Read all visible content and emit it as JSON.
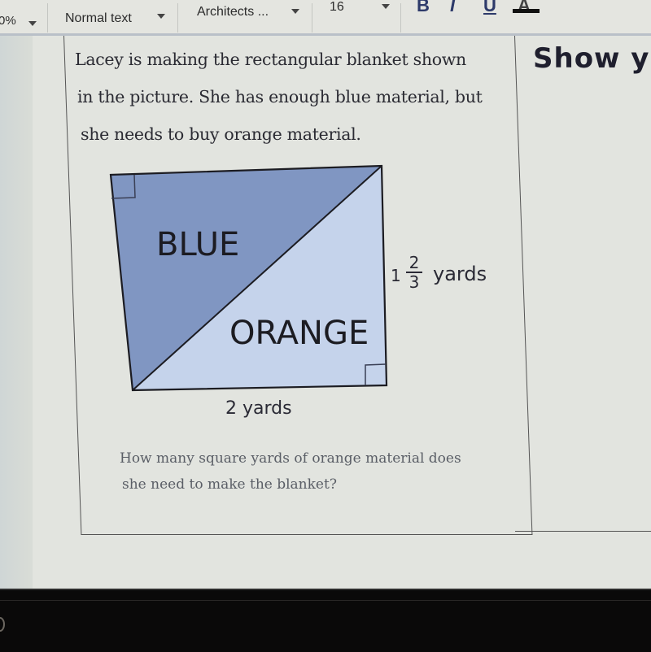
{
  "toolbar": {
    "zoom_value": "0%",
    "style_select": "Normal text",
    "font_select": "Architects ...",
    "font_size": "16",
    "bold": "B",
    "italic": "I",
    "underline": "U",
    "text_color": "A"
  },
  "document": {
    "problem_lines": [
      "Lacey is making the rectangular blanket shown",
      "in the picture. She has enough blue material, but",
      "she needs to buy orange material."
    ],
    "show_work_heading": "Show y",
    "figure": {
      "blue_label": "BLUE",
      "orange_label": "ORANGE",
      "height_whole": "1",
      "height_numerator": "2",
      "height_denominator": "3",
      "height_unit": "yards",
      "width_label": "2 yards",
      "colors": {
        "blue_region": "#8096c2",
        "orange_region": "#c5d3eb",
        "outline": "#1c1c22"
      }
    },
    "question_lines": [
      "How many square yards of orange material does",
      "she need to make the blanket?"
    ]
  }
}
